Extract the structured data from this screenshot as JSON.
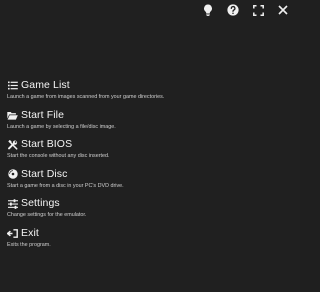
{
  "toolbar": {
    "icons": [
      "lightbulb-icon",
      "help-icon",
      "fullscreen-icon",
      "close-icon"
    ]
  },
  "menu": {
    "items": [
      {
        "title": "Game List",
        "description": "Launch a game from images scanned from your game directories.",
        "icon": "list-icon"
      },
      {
        "title": "Start File",
        "description": "Launch a game by selecting a file/disc image.",
        "icon": "folder-open-icon"
      },
      {
        "title": "Start BIOS",
        "description": "Start the console without any disc inserted.",
        "icon": "tools-icon"
      },
      {
        "title": "Start Disc",
        "description": "Start a game from a disc in your PC's DVD drive.",
        "icon": "disc-icon"
      },
      {
        "title": "Settings",
        "description": "Change settings for the emulator.",
        "icon": "sliders-icon"
      },
      {
        "title": "Exit",
        "description": "Exits the program.",
        "icon": "exit-icon"
      }
    ]
  }
}
